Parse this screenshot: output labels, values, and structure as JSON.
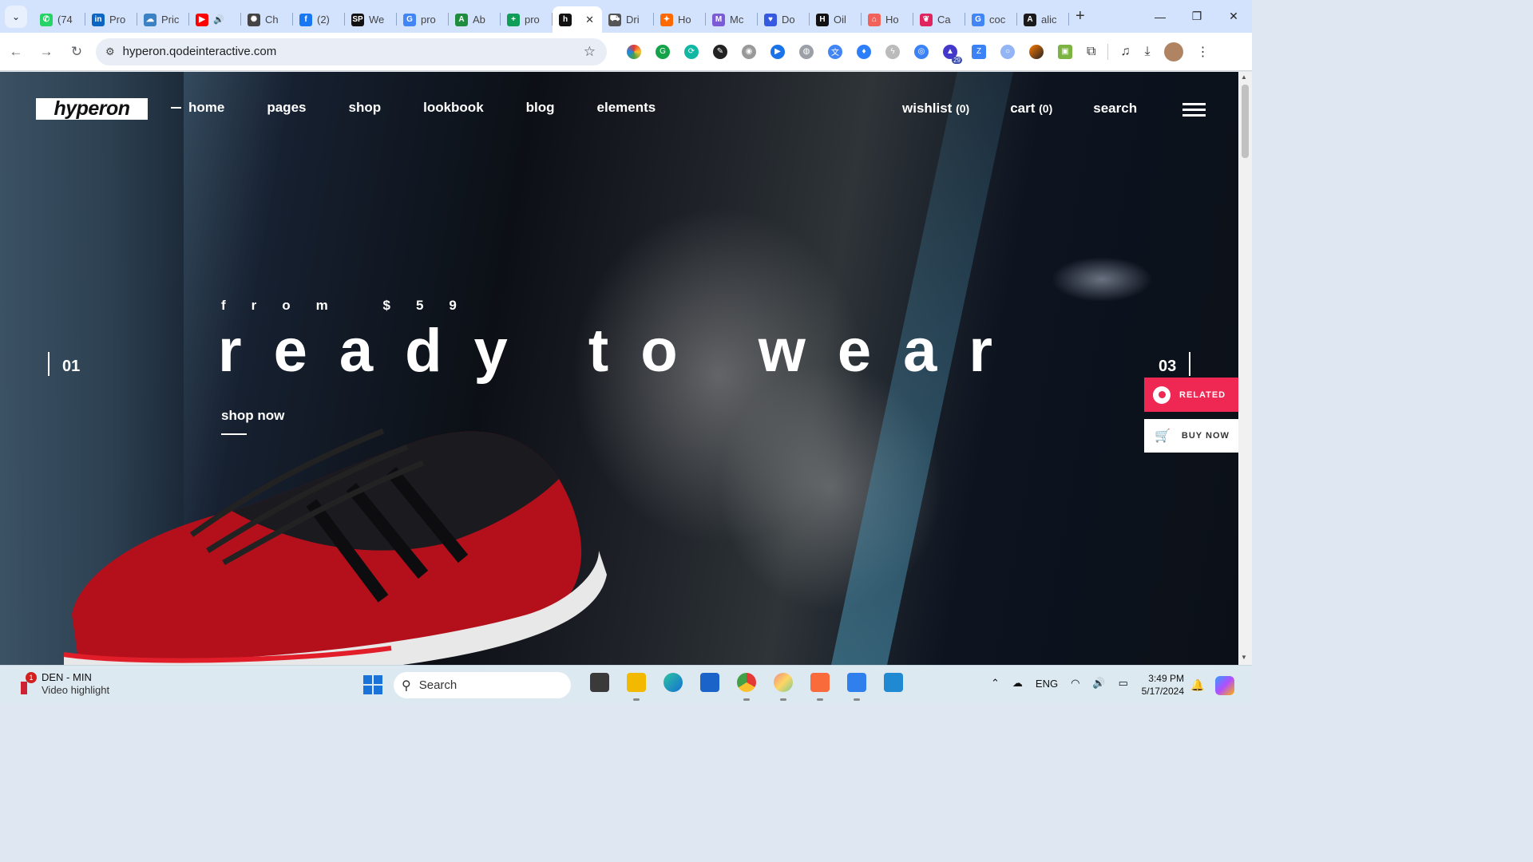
{
  "browser": {
    "tabs": [
      {
        "label": "(74",
        "icon": "whatsapp-icon",
        "color": "#25d366",
        "glyph": "✆"
      },
      {
        "label": "Pro",
        "icon": "linkedin-icon",
        "color": "#0a66c2",
        "glyph": "in"
      },
      {
        "label": "Pric",
        "icon": "cloud-icon",
        "color": "#3b82c4",
        "glyph": "☁"
      },
      {
        "label": "",
        "icon": "youtube-icon",
        "color": "#ff0000",
        "glyph": "▶"
      },
      {
        "label": "Ch",
        "icon": "openai-icon",
        "color": "#444444",
        "glyph": "✺"
      },
      {
        "label": "(2)",
        "icon": "facebook-icon",
        "color": "#1877f2",
        "glyph": "f"
      },
      {
        "label": "We",
        "icon": "sp-icon",
        "color": "#111111",
        "glyph": "SP"
      },
      {
        "label": "pro",
        "icon": "google-icon",
        "color": "#4285f4",
        "glyph": "G"
      },
      {
        "label": "Ab",
        "icon": "brand-icon",
        "color": "#1e8e3e",
        "glyph": "A"
      },
      {
        "label": "pro",
        "icon": "sheets-icon",
        "color": "#0f9d58",
        "glyph": "+"
      },
      {
        "label": "",
        "icon": "hyperon-icon",
        "color": "#111111",
        "glyph": "h",
        "active": true
      },
      {
        "label": "Dri",
        "icon": "car-icon",
        "color": "#555555",
        "glyph": "⛟"
      },
      {
        "label": "Ho",
        "icon": "fox-icon",
        "color": "#ff6a00",
        "glyph": "✦"
      },
      {
        "label": "Mc",
        "icon": "mc-icon",
        "color": "#7b5cd6",
        "glyph": "M"
      },
      {
        "label": "Do",
        "icon": "heart-icon",
        "color": "#3559e0",
        "glyph": "♥"
      },
      {
        "label": "Oil",
        "icon": "h-logo-icon",
        "color": "#111111",
        "glyph": "H"
      },
      {
        "label": "Ho",
        "icon": "home-icon",
        "color": "#f0625a",
        "glyph": "⌂"
      },
      {
        "label": "Ca",
        "icon": "lips-icon",
        "color": "#e0245e",
        "glyph": "❦"
      },
      {
        "label": "coc",
        "icon": "google-icon",
        "color": "#4285f4",
        "glyph": "G"
      },
      {
        "label": "alic",
        "icon": "alicorn-icon",
        "color": "#1a1a1a",
        "glyph": "A"
      }
    ],
    "url": "hyperon.qodeinteractive.com",
    "extension_badge": "29"
  },
  "site": {
    "logo": "hyperon",
    "nav": [
      {
        "label": "home",
        "active": true
      },
      {
        "label": "pages"
      },
      {
        "label": "shop"
      },
      {
        "label": "lookbook"
      },
      {
        "label": "blog"
      },
      {
        "label": "elements"
      }
    ],
    "wishlist": {
      "label": "wishlist",
      "count": "(0)"
    },
    "cart": {
      "label": "cart",
      "count": "(0)"
    },
    "search": "search",
    "hero": {
      "eyebrow": "from $59",
      "headline": "ready to wear",
      "cta": "shop now",
      "slide_current": "01",
      "slide_total": "03"
    },
    "side_buttons": {
      "related": "RELATED",
      "buy_now": "BUY NOW"
    },
    "accent_color": "#ee2852"
  },
  "taskbar": {
    "notification_badge": "1",
    "notification_title": "DEN - MIN",
    "notification_sub": "Video highlight",
    "search_placeholder": "Search",
    "language": "ENG",
    "time": "3:49 PM",
    "date": "5/17/2024"
  }
}
